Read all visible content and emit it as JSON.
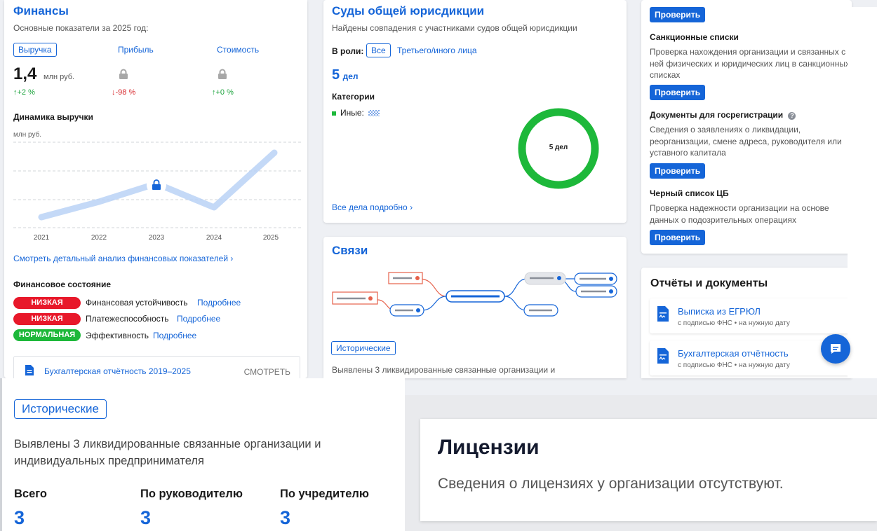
{
  "colors": {
    "accent": "#1565d8",
    "danger": "#e8182a",
    "success": "#1db83a"
  },
  "finance": {
    "title": "Финансы",
    "subtitle": "Основные показатели за 2025 год:",
    "tabs": {
      "revenue": "Выручка",
      "profit": "Прибыль",
      "value": "Стоимость"
    },
    "revenue_value": "1,4",
    "revenue_unit": "млн руб.",
    "revenue_change": "+2 %",
    "profit_change": "-98 %",
    "value_change": "+0 %",
    "chart_title": "Динамика выручки",
    "chart_unit": "млн руб.",
    "detail_link": "Смотреть детальный анализ финансовых показателей",
    "state_title": "Финансовое состояние",
    "states": [
      {
        "badge": "НИЗКАЯ",
        "label": "Финансовая устойчивость",
        "more": "Подробнее"
      },
      {
        "badge": "НИЗКАЯ",
        "label": "Платежеспособность",
        "more": "Подробнее"
      },
      {
        "badge": "НОРМАЛЬНАЯ",
        "label": "Эффективность",
        "more": "Подробнее"
      }
    ],
    "report_label": "Бухгалтерская отчётность 2019–2025",
    "report_action": "СМОТРЕТЬ"
  },
  "chart_data": {
    "type": "line",
    "title": "Динамика выручки",
    "ylabel": "млн руб.",
    "x": [
      "2021",
      "2022",
      "2023",
      "2024",
      "2025"
    ],
    "values_hidden": true,
    "note": "values hidden behind lock"
  },
  "courts": {
    "title": "Суды общей юрисдикции",
    "subtitle": "Найдены совпадения с участниками судов общей юрисдикции",
    "role_label": "В роли:",
    "role_all": "Все",
    "role_third": "Третьего/иного лица",
    "count": "5",
    "count_unit": "дел",
    "categories_title": "Категории",
    "category_other": "Иные:",
    "donut_label": "5 дел",
    "all_link": "Все дела подробно"
  },
  "links": {
    "title": "Связи",
    "tag": "Исторические",
    "text": "Выявлены 3 ликвидированные связанные организации и"
  },
  "checks": {
    "button": "Проверить",
    "items": [
      {
        "title": "Санкционные списки",
        "text": "Проверка нахождения организации и связанных с ней физических и юридических лиц в санкционных списках"
      },
      {
        "title": "Документы для госрегистрации",
        "text": "Сведения о заявлениях о ликвидации, реорганизации, смене адреса, руководителя или уставного капитала"
      },
      {
        "title": "Черный список ЦБ",
        "text": "Проверка надежности организации на основе данных о подозрительных операциях"
      }
    ]
  },
  "reports": {
    "title": "Отчёты и документы",
    "items": [
      {
        "title": "Выписка из ЕГРЮЛ",
        "sub": "с подписью ФНС • на нужную дату"
      },
      {
        "title": "Бухгалтерская отчётность",
        "sub": "с подписью ФНС • на нужную дату"
      }
    ]
  },
  "historic_zoom": {
    "tag": "Исторические",
    "text_line1": "Выявлены 3 ликвидированные связанные организации и",
    "text_line2": "индивидуальных предпринимателя",
    "cols": [
      {
        "label": "Всего",
        "value": "3"
      },
      {
        "label": "По руководителю",
        "value": "3"
      },
      {
        "label": "По учредителю",
        "value": "3"
      }
    ]
  },
  "licenses": {
    "title": "Лицензии",
    "text": "Сведения о лицензиях у организации отсутствуют."
  }
}
